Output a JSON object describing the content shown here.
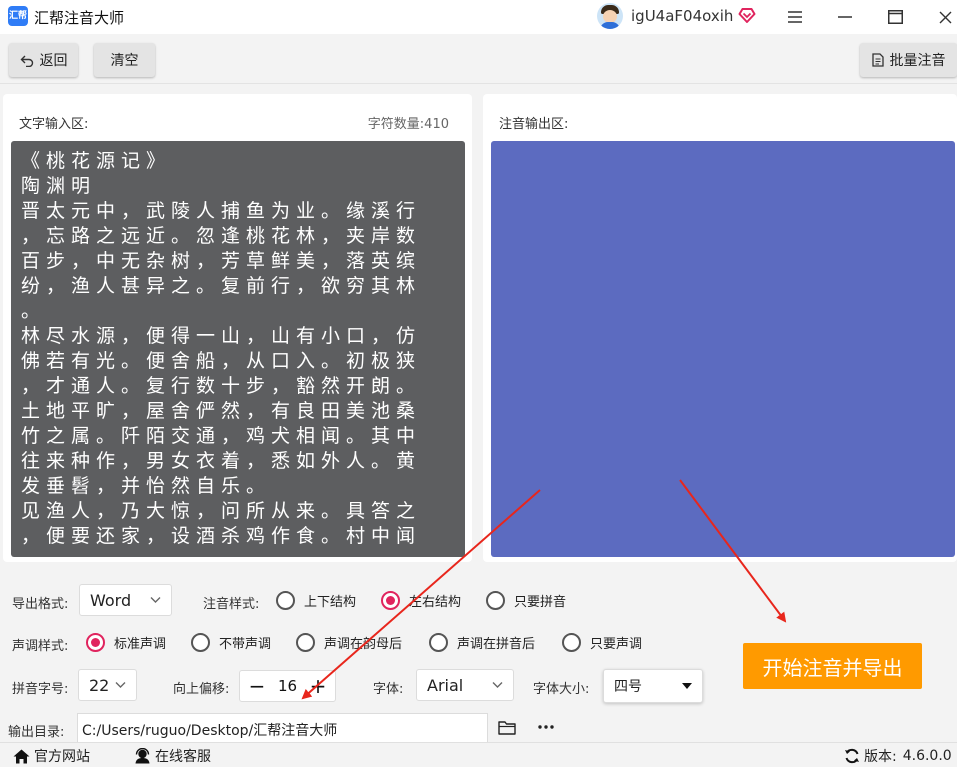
{
  "app": {
    "logo_text": "汇帮",
    "title": "汇帮注音大师",
    "username": "igU4aF04oxih"
  },
  "toolbar": {
    "back_label": "返回",
    "clear_label": "清空",
    "batch_label": "批量注音"
  },
  "input_panel": {
    "label": "文字输入区:",
    "char_count_label": "字符数量:",
    "char_count": "410",
    "lines": [
      "《桃花源记》",
      "陶渊明",
      "晋太元中，武陵人捕鱼为业。缘溪行",
      "，忘路之远近。忽逢桃花林，夹岸数",
      "百步，中无杂树，芳草鲜美，落英缤",
      "纷，渔人甚异之。复前行，欲穷其林",
      "。",
      "林尽水源，便得一山，山有小口，仿",
      "佛若有光。便舍船，从口入。初极狭",
      "，才通人。复行数十步，豁然开朗。",
      "土地平旷，屋舍俨然，有良田美池桑",
      "竹之属。阡陌交通，鸡犬相闻。其中",
      "往来种作，男女衣着，悉如外人。黄",
      "发垂髫，并怡然自乐。",
      "见渔人，乃大惊，问所从来。具答之",
      "，便要还家，设酒杀鸡作食。村中闻"
    ]
  },
  "output_panel": {
    "label": "注音输出区:"
  },
  "export_format": {
    "label": "导出格式:",
    "value": "Word"
  },
  "annotation_style": {
    "label": "注音样式:",
    "options": [
      "上下结构",
      "左右结构",
      "只要拼音"
    ],
    "selected": "左右结构"
  },
  "tone_style": {
    "label": "声调样式:",
    "options": [
      "标准声调",
      "不带声调",
      "声调在韵母后",
      "声调在拼音后",
      "只要声调"
    ],
    "selected": "标准声调"
  },
  "pinyin_size": {
    "label": "拼音字号:",
    "value": "22"
  },
  "offset": {
    "label": "向上偏移:",
    "value": "16",
    "dec": "−",
    "inc": "+"
  },
  "font": {
    "label": "字体:",
    "value": "Arial"
  },
  "font_size": {
    "label": "字体大小:",
    "value": "四号"
  },
  "start_button": {
    "label": "开始注音并导出"
  },
  "output_dir": {
    "label": "输出目录:",
    "value": "C:/Users/ruguo/Desktop/汇帮注音大师"
  },
  "statusbar": {
    "website": "官方网站",
    "support": "在线客服",
    "version_label": "版本:",
    "version": "4.6.0.0"
  },
  "colors": {
    "accent": "#ff9a00",
    "radio_checked": "#e0245e",
    "output_bg": "#5c6bc0",
    "input_bg": "#5d5e60",
    "arrow": "#e8261c"
  },
  "icons": [
    "back-arrow-icon",
    "document-icon",
    "vip-heart-icon",
    "menu-icon",
    "minimize-icon",
    "maximize-icon",
    "close-icon",
    "folder-icon",
    "more-icon",
    "home-icon",
    "support-icon",
    "refresh-icon"
  ]
}
